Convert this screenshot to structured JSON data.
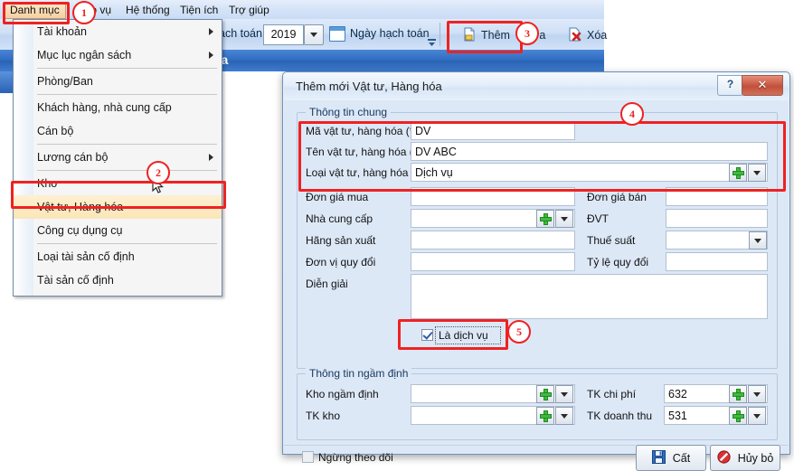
{
  "app": {
    "menubar": [
      {
        "label": "Danh mục",
        "name": "menu-danh-muc"
      },
      {
        "label": "iệp vụ",
        "name": "menu-nghiep-vu"
      },
      {
        "label": "Hệ thống",
        "name": "menu-he-thong"
      },
      {
        "label": "Tiện ích",
        "name": "menu-tien-ich"
      },
      {
        "label": "Trợ giúp",
        "name": "menu-tro-giup"
      }
    ],
    "toolbar": {
      "fiscal_label": "ạch toán",
      "year_value": "2019",
      "date_button": "Ngày hạch toán",
      "add_button": "Thêm",
      "edit_button": "ửa",
      "delete_button": "Xóa"
    },
    "page_title": "óa"
  },
  "dropdown": {
    "items": [
      {
        "label": "Tài khoản",
        "submenu": true,
        "sep_after": false
      },
      {
        "label": "Mục lục ngân sách",
        "submenu": true,
        "sep_after": true
      },
      {
        "label": "Phòng/Ban",
        "submenu": false,
        "sep_after": true
      },
      {
        "label": "Khách hàng, nhà cung cấp",
        "submenu": false,
        "sep_after": false
      },
      {
        "label": "Cán bộ",
        "submenu": false,
        "sep_after": true
      },
      {
        "label": "Lương cán bộ",
        "submenu": true,
        "sep_after": true
      },
      {
        "label": "Kho",
        "submenu": false,
        "sep_after": false
      },
      {
        "label": "Vật tư, Hàng hóa",
        "submenu": false,
        "sep_after": false,
        "highlighted": true
      },
      {
        "label": "Công cụ dụng cụ",
        "submenu": false,
        "sep_after": true
      },
      {
        "label": "Loại tài sản cố định",
        "submenu": false,
        "sep_after": false
      },
      {
        "label": "Tài sản cố định",
        "submenu": false,
        "sep_after": false
      }
    ]
  },
  "dialog": {
    "title": "Thêm mới Vật tư, Hàng hóa",
    "help_button": "?",
    "close_button": "✕",
    "group_general": "Thông tin chung",
    "group_default": "Thông tin ngầm định",
    "fields": {
      "ma_label": "Mã vật tư, hàng hóa (*)",
      "ma_value": "DV",
      "ten_label": "Tên vật tư, hàng hóa (*)",
      "ten_value": "DV ABC",
      "loai_label": "Loại vật tư, hàng hóa (*)",
      "loai_value": "Dịch vụ",
      "dongiamua_label": "Đơn giá mua",
      "dongiamua_value": "",
      "nhacungcap_label": "Nhà cung cấp",
      "nhacungcap_value": "",
      "hangsanxuat_label": "Hãng sản xuất",
      "hangsanxuat_value": "",
      "donviquydoi_label": "Đơn vị quy đổi",
      "donviquydoi_value": "",
      "dongiaban_label": "Đơn giá bán",
      "dongiaban_value": "",
      "dvt_label": "ĐVT",
      "dvt_value": "",
      "thuesuat_label": "Thuế suất",
      "thuesuat_value": "",
      "tylequydoi_label": "Tỷ lệ quy đổi",
      "tylequydoi_value": "",
      "diengiai_label": "Diễn giải",
      "diengiai_value": "",
      "ladichvu_label": "Là dịch vụ",
      "khongamdinh_label": "Kho ngầm định",
      "khongamdinh_value": "",
      "tkkho_label": "TK kho",
      "tkkho_value": "",
      "tkchiphi_label": "TK chi phí",
      "tkchiphi_value": "632",
      "tkdoanhthu_label": "TK doanh thu",
      "tkdoanhthu_value": "531",
      "ngungtheodoi_label": "Ngừng theo dõi"
    },
    "footer": {
      "save_button": "Cất",
      "cancel_button": "Hủy bỏ"
    }
  },
  "annotations": {
    "steps": [
      "1",
      "2",
      "3",
      "4",
      "5"
    ]
  },
  "colors": {
    "annotation_red": "#ee2222",
    "highlight_yellow": "#fbe6b8",
    "title_blue": "#2f6cc0"
  }
}
